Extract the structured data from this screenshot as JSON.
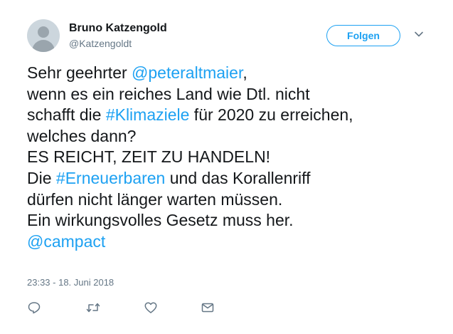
{
  "tweet": {
    "author_name": "Bruno Katzengold",
    "author_handle": "@Katzengoldt",
    "follow_label": "Folgen",
    "lines": [
      [
        {
          "text": "Sehr geehrter ",
          "link": false
        },
        {
          "text": "@peteraltmaier",
          "link": true
        },
        {
          "text": ",",
          "link": false
        }
      ],
      [
        {
          "text": "wenn es ein reiches Land wie Dtl. nicht",
          "link": false
        }
      ],
      [
        {
          "text": "schafft die ",
          "link": false
        },
        {
          "text": "#Klimaziele",
          "link": true
        },
        {
          "text": " für 2020 zu erreichen,",
          "link": false
        }
      ],
      [
        {
          "text": "welches dann?",
          "link": false
        }
      ],
      [
        {
          "text": "ES REICHT, ZEIT ZU HANDELN!",
          "link": false
        }
      ],
      [
        {
          "text": "Die ",
          "link": false
        },
        {
          "text": "#Erneuerbaren",
          "link": true
        },
        {
          "text": " und das Korallenriff",
          "link": false
        }
      ],
      [
        {
          "text": "dürfen nicht länger warten müssen.",
          "link": false
        }
      ],
      [
        {
          "text": "Ein wirkungsvolles Gesetz muss her.",
          "link": false
        }
      ],
      [
        {
          "text": "@campact",
          "link": true
        }
      ]
    ],
    "timestamp": "23:33 - 18. Juni 2018"
  },
  "icons": {
    "avatar": "default-avatar-icon",
    "caret": "chevron-down-icon",
    "actions": [
      "reply-icon",
      "retweet-icon",
      "like-icon",
      "direct-message-icon"
    ]
  },
  "colors": {
    "link": "#1da1f2",
    "text": "#14171a",
    "muted": "#657786",
    "icon": "#657786"
  }
}
